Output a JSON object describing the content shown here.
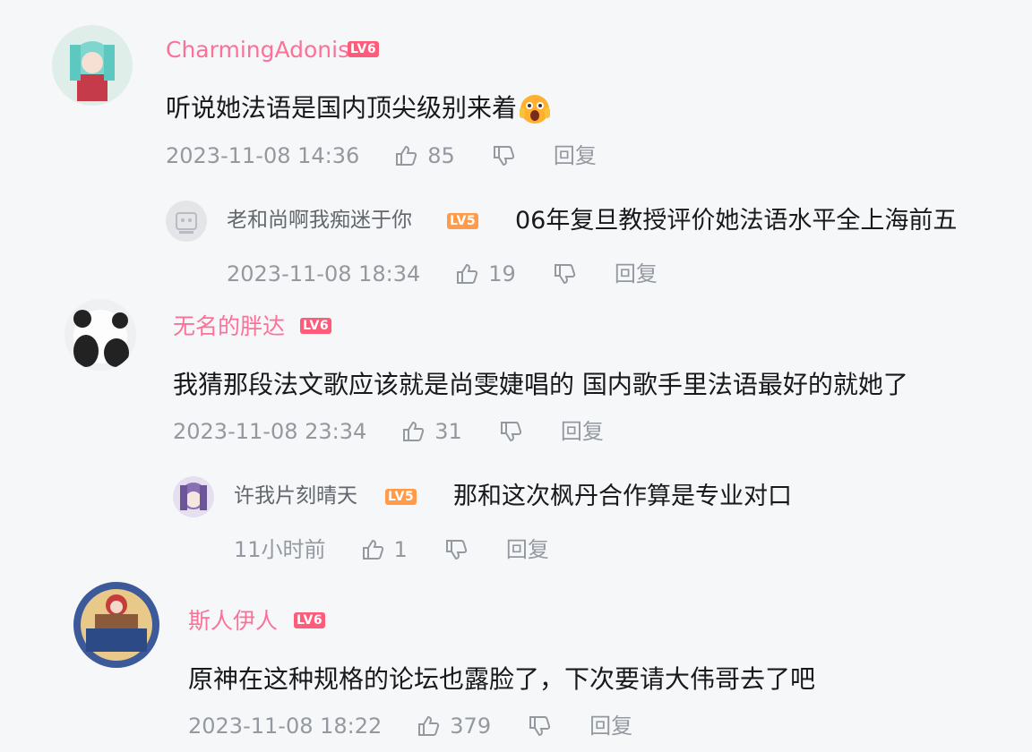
{
  "reply_label": "回复",
  "colors": {
    "username_main": "#fb7299",
    "username_reply": "#61666d",
    "meta": "#9499a0",
    "text": "#18191c",
    "lv6": "#ff5c7c",
    "lv5": "#ff9b4a"
  },
  "comments": [
    {
      "username": "CharmingAdonis",
      "level": "LV6",
      "text": "听说她法语是国内顶尖级别来着",
      "emoji": "scream-emoji",
      "time": "2023-11-08 14:36",
      "likes": "85"
    },
    {
      "username": "老和尚啊我痴迷于你",
      "level": "LV5",
      "text": "06年复旦教授评价她法语水平全上海前五",
      "time": "2023-11-08 18:34",
      "likes": "19"
    },
    {
      "username": "无名的胖达",
      "level": "LV6",
      "text": "我猜那段法文歌应该就是尚雯婕唱的 国内歌手里法语最好的就她了",
      "time": "2023-11-08 23:34",
      "likes": "31"
    },
    {
      "username": "许我片刻晴天",
      "level": "LV5",
      "text": "那和这次枫丹合作算是专业对口",
      "time": "11小时前",
      "likes": "1"
    },
    {
      "username": "斯人伊人",
      "level": "LV6",
      "text": "原神在这种规格的论坛也露脸了，下次要请大伟哥去了吧",
      "time": "2023-11-08 18:22",
      "likes": "379"
    }
  ]
}
